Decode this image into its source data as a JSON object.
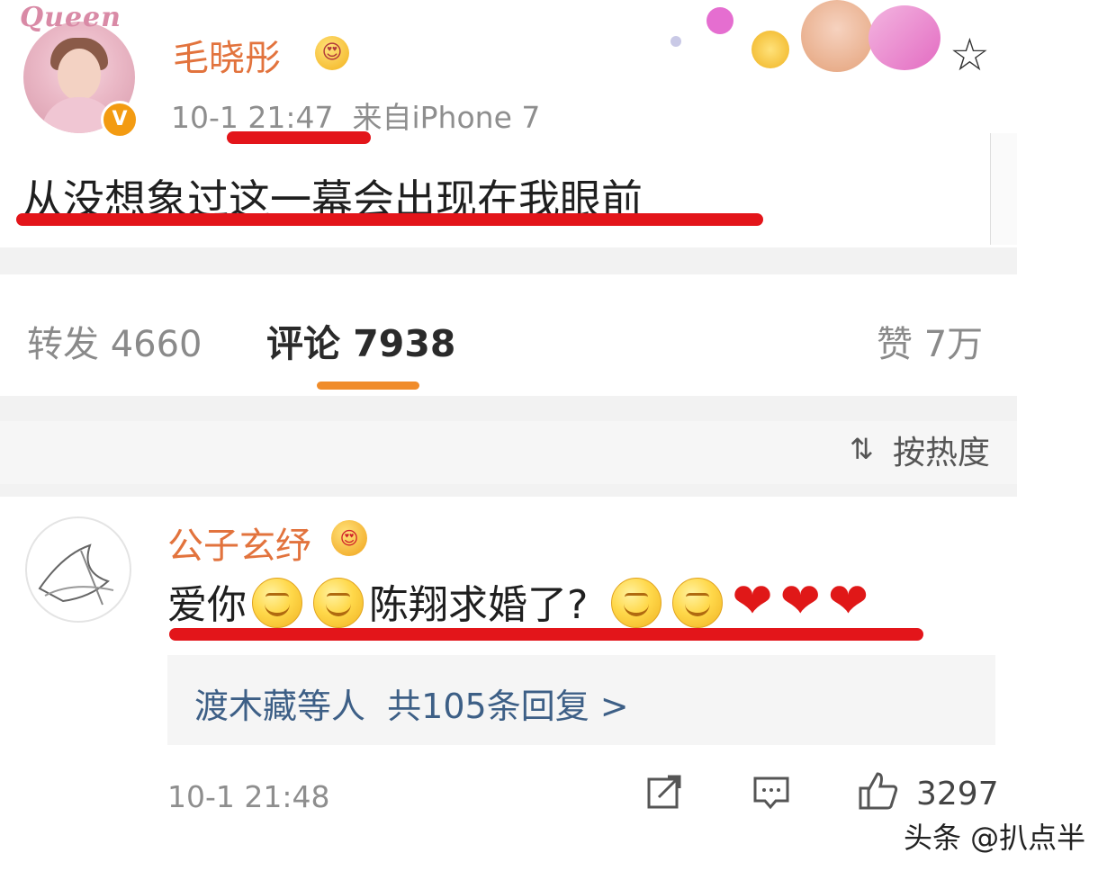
{
  "post": {
    "logo_text": "Queen",
    "username": "毛晓彤",
    "verified_mark": "V",
    "user_emoji": "😍",
    "time": "10-1 21:47",
    "source": "来自iPhone 7",
    "text": "从没想象过这一幕会出现在我眼前",
    "more_icon": "⋮"
  },
  "stats": {
    "repost_label": "转发 4660",
    "comment_label": "评论 7938",
    "like_label": "赞 7万"
  },
  "sort": {
    "label": "按热度",
    "icon": "sort-icon"
  },
  "comment": {
    "author": "公子玄纾",
    "author_emoji": "😍",
    "text_part1": "爱你",
    "text_part2": "陈翔求婚了?",
    "reply_summary": "渡木藏等人  共105条回复 >",
    "time": "10-1 21:48",
    "like_count": "3297"
  },
  "watermark": "头条 @扒点半",
  "colors": {
    "accent_orange": "#e2733d",
    "highlight_red": "#e3151a",
    "link_blue": "#3d5f86"
  }
}
